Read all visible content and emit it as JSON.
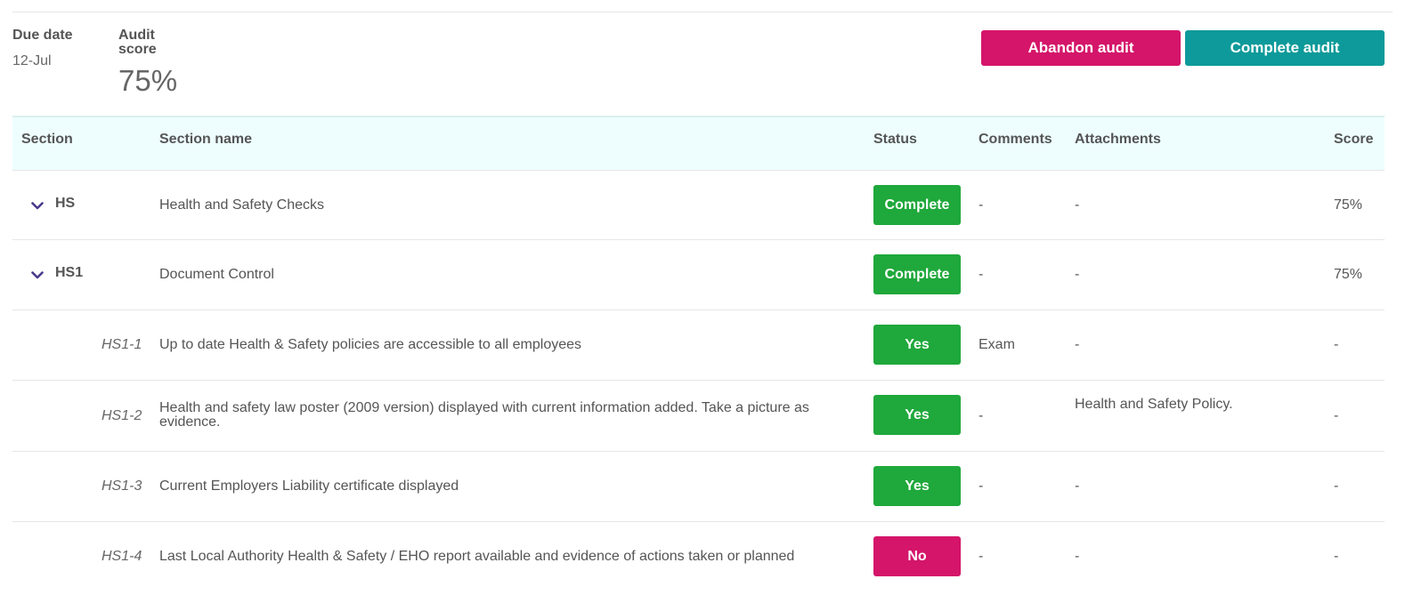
{
  "header": {
    "due_date_label": "Due date",
    "due_date_value": "12-Jul",
    "audit_score_label": "Audit score",
    "audit_score_value": "75%"
  },
  "actions": {
    "abandon_label": "Abandon audit",
    "complete_label": "Complete audit"
  },
  "colors": {
    "abandon": "#d4156a",
    "complete": "#0e9a9a",
    "status_green": "#1fa83b",
    "status_pink": "#d4156a",
    "chevron": "#4b3a8c",
    "header_bg": "#eefefe"
  },
  "table": {
    "columns": [
      "Section",
      "Section name",
      "Status",
      "Comments",
      "Attachments",
      "Score"
    ],
    "rows": [
      {
        "code": "HS",
        "name": "Health and Safety Checks",
        "status": "Complete",
        "comments": "-",
        "attachments": "-",
        "score": "75%"
      },
      {
        "code": "HS1",
        "name": "Document Control",
        "status": "Complete",
        "comments": "-",
        "attachments": "-",
        "score": "75%"
      },
      {
        "code": "HS1-1",
        "name": "Up to date Health & Safety policies are accessible to all employees",
        "status": "Yes",
        "comments": "Exam",
        "attachments": "-",
        "score": "-"
      },
      {
        "code": "HS1-2",
        "name": "Health and safety law poster (2009 version) displayed with current information added. Take a picture as evidence.",
        "status": "Yes",
        "comments": "-",
        "attachments": "Health and Safety Policy.",
        "score": "-"
      },
      {
        "code": "HS1-3",
        "name": "Current Employers Liability certificate displayed",
        "status": "Yes",
        "comments": "-",
        "attachments": "-",
        "score": "-"
      },
      {
        "code": "HS1-4",
        "name": "Last Local Authority Health & Safety / EHO report available and evidence of actions taken or planned",
        "status": "No",
        "comments": "-",
        "attachments": "-",
        "score": "-"
      }
    ]
  }
}
